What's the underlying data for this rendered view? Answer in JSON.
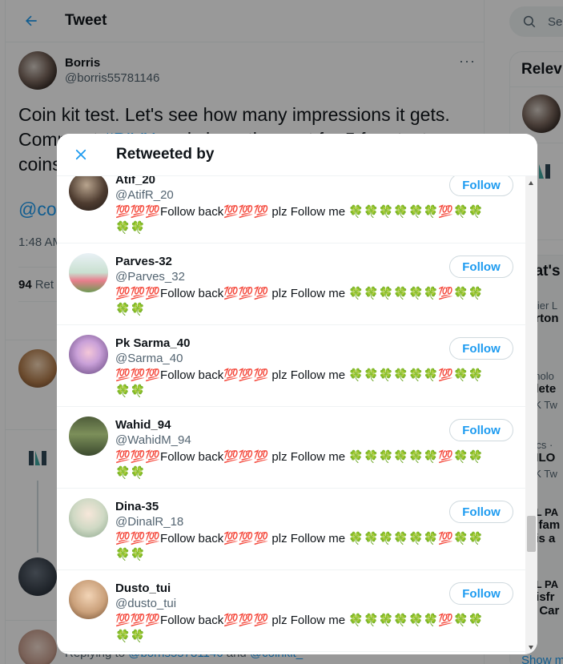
{
  "colors": {
    "accent": "#1d9bf0",
    "text": "#0f1419",
    "muted": "#536471",
    "overlay": "rgba(0,0,0,0.4)"
  },
  "header": {
    "title": "Tweet",
    "back_icon": "arrow-left-icon"
  },
  "tweet": {
    "author_name": "Borris",
    "author_handle": "@borris55781146",
    "text_line1": "Coin kit test. Let's see how many impressions it gets.",
    "text_line2a": "Comment ",
    "text_hashtag": "#PIVX",
    "text_line2b": " and share the post for 5 free test",
    "text_line3": "coins",
    "mention_line": "@co",
    "time": "1:48 AM",
    "retweets_count": "94",
    "retweets_label": "Ret",
    "replying_prefix": "Replying to",
    "replying_user1": "@borris55781146",
    "replying_and": "and",
    "replying_user2": "@coinkit_"
  },
  "sidebar": {
    "search_placeholder": "Se",
    "relevant_heading": "Relev",
    "whats_heading": "hat's",
    "trends": [
      {
        "sub": "mier L",
        "title": "erton"
      },
      {
        "sub": "hnolo",
        "title": "elete",
        "count": "6K Tw"
      },
      {
        "sub": "itics ·",
        "title": "MLO",
        "count": "9K Tw"
      },
      {
        "sub": "EL PA",
        "title": "s fam",
        "title2": "sis a"
      },
      {
        "sub": "EL PA",
        "title": "disfr",
        "title2": "n Car"
      }
    ],
    "show_more": "Show m"
  },
  "modal": {
    "title": "Retweeted by",
    "close_icon": "close-icon",
    "follow_label": "Follow",
    "users": [
      {
        "name": "Atif_20",
        "handle": "@AtifR_20",
        "bio_line1": "💯💯💯Follow back💯💯💯 plz Follow me 🍀🍀🍀🍀🍀🍀💯🍀🍀",
        "bio_line2": "🍀🍀"
      },
      {
        "name": "Parves-32",
        "handle": "@Parves_32",
        "bio_line1": "💯💯💯Follow back💯💯💯 plz Follow me 🍀🍀🍀🍀🍀🍀💯🍀🍀",
        "bio_line2": "🍀🍀"
      },
      {
        "name": "Pk Sarma_40",
        "handle": "@Sarma_40",
        "bio_line1": "💯💯💯Follow back💯💯💯 plz Follow me 🍀🍀🍀🍀🍀🍀💯🍀🍀",
        "bio_line2": "🍀🍀"
      },
      {
        "name": "Wahid_94",
        "handle": "@WahidM_94",
        "bio_line1": "💯💯💯Follow back💯💯💯 plz Follow me 🍀🍀🍀🍀🍀🍀💯🍀🍀",
        "bio_line2": "🍀🍀"
      },
      {
        "name": "Dina-35",
        "handle": "@DinalR_18",
        "bio_line1": "💯💯💯Follow back💯💯💯 plz Follow me 🍀🍀🍀🍀🍀🍀💯🍀🍀",
        "bio_line2": "🍀🍀"
      },
      {
        "name": "Dusto_tui",
        "handle": "@dusto_tui",
        "bio_line1": "💯💯💯Follow back💯💯💯 plz Follow me 🍀🍀🍀🍀🍀🍀💯🍀🍀",
        "bio_line2": "🍀🍀"
      }
    ]
  }
}
